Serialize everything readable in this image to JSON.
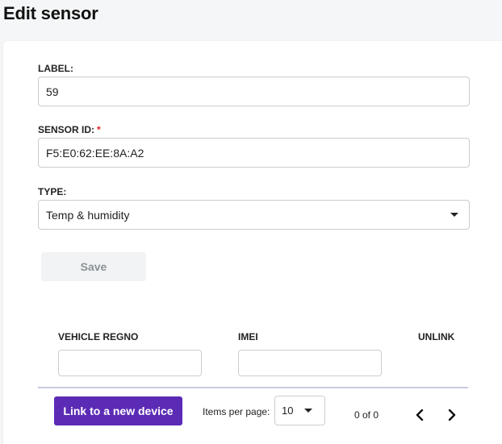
{
  "page": {
    "title": "Edit sensor"
  },
  "form": {
    "label": {
      "label": "LABEL:",
      "value": "59"
    },
    "sensor_id": {
      "label": "SENSOR ID:",
      "required_mark": "*",
      "value": "F5:E0:62:EE:8A:A2"
    },
    "type": {
      "label": "TYPE:",
      "selected": "Temp & humidity"
    },
    "save_label": "Save"
  },
  "table": {
    "columns": [
      "VEHICLE REGNO",
      "IMEI",
      "UNLINK"
    ]
  },
  "footer": {
    "link_button": "Link to a new device",
    "items_per_page_label": "Items per page:",
    "items_per_page_value": "10",
    "range_label": "0 of 0"
  },
  "icons": {
    "dropdown": "chevron-down-icon",
    "prev": "chevron-left-icon",
    "next": "chevron-right-icon"
  },
  "colors": {
    "primary": "#5b2bb5",
    "required": "#e02020"
  }
}
